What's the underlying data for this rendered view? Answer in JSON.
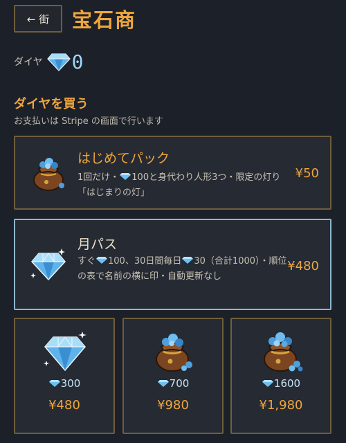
{
  "header": {
    "back_label": "← 街",
    "title": "宝石商"
  },
  "balance": {
    "label": "ダイヤ",
    "value": "0",
    "icon": "diamond-icon"
  },
  "section": {
    "title": "ダイヤを買う",
    "subtitle": "お支払いは Stripe の画面で行います"
  },
  "offers": [
    {
      "title": "はじめてパック",
      "desc_before": "1回だけ・",
      "desc_after": "100と身代わり人形3つ・限定の灯り「はじまりの灯」",
      "price": "¥50",
      "icon": "gem-bag-icon"
    },
    {
      "title": "月パス",
      "desc_a": "すぐ",
      "desc_b": "100、30日間毎日",
      "desc_c": "30（合計1000）・順位の表で名前の横に印・自動更新なし",
      "price": "¥480",
      "icon": "diamond-icon"
    }
  ],
  "packs": [
    {
      "amount": "300",
      "price": "¥480",
      "icon": "diamond-icon"
    },
    {
      "amount": "700",
      "price": "¥980",
      "icon": "gem-bag-icon"
    },
    {
      "amount": "1600",
      "price": "¥1,980",
      "icon": "gem-bag-icon"
    }
  ],
  "colors": {
    "background": "#1c2029",
    "accent": "#efa63c",
    "diamond": "#9ed6f7",
    "card_border": "#6f5e3c",
    "selected_border": "#8eb7d0"
  }
}
